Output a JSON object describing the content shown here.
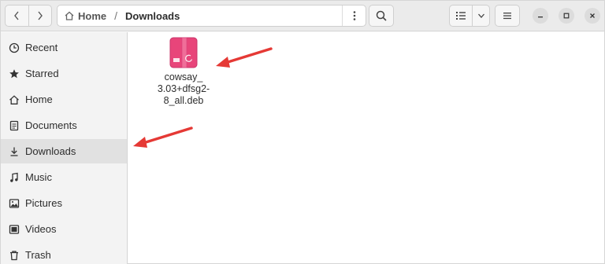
{
  "headerbar": {
    "back_icon": "chevron-left-icon",
    "forward_icon": "chevron-right-icon",
    "path": {
      "home_label": "Home",
      "separator": "/",
      "current_label": "Downloads"
    },
    "menu_icon": "kebab-menu-icon",
    "search_icon": "search-icon",
    "view_icon": "list-view-icon",
    "view_dropdown_icon": "chevron-down-icon",
    "app_menu_icon": "hamburger-menu-icon",
    "window_controls": [
      "minimize-icon",
      "maximize-icon",
      "close-icon"
    ]
  },
  "sidebar": {
    "items": [
      {
        "label": "Recent",
        "icon": "clock-icon",
        "active": false
      },
      {
        "label": "Starred",
        "icon": "star-icon",
        "active": false
      },
      {
        "label": "Home",
        "icon": "home-icon",
        "active": false
      },
      {
        "label": "Documents",
        "icon": "document-icon",
        "active": false
      },
      {
        "label": "Downloads",
        "icon": "download-icon",
        "active": true
      },
      {
        "label": "Music",
        "icon": "music-icon",
        "active": false
      },
      {
        "label": "Pictures",
        "icon": "picture-icon",
        "active": false
      },
      {
        "label": "Videos",
        "icon": "video-icon",
        "active": false
      },
      {
        "label": "Trash",
        "icon": "trash-icon",
        "active": false
      }
    ]
  },
  "files": [
    {
      "name_lines": [
        "cowsay_",
        "3.03+dfsg2-",
        "8_all.deb"
      ],
      "icon": "deb-package-icon"
    }
  ],
  "colors": {
    "annotation_arrow": "#e53935",
    "package_icon": "#e8457a",
    "sidebar_active": "#e1e1e1"
  }
}
